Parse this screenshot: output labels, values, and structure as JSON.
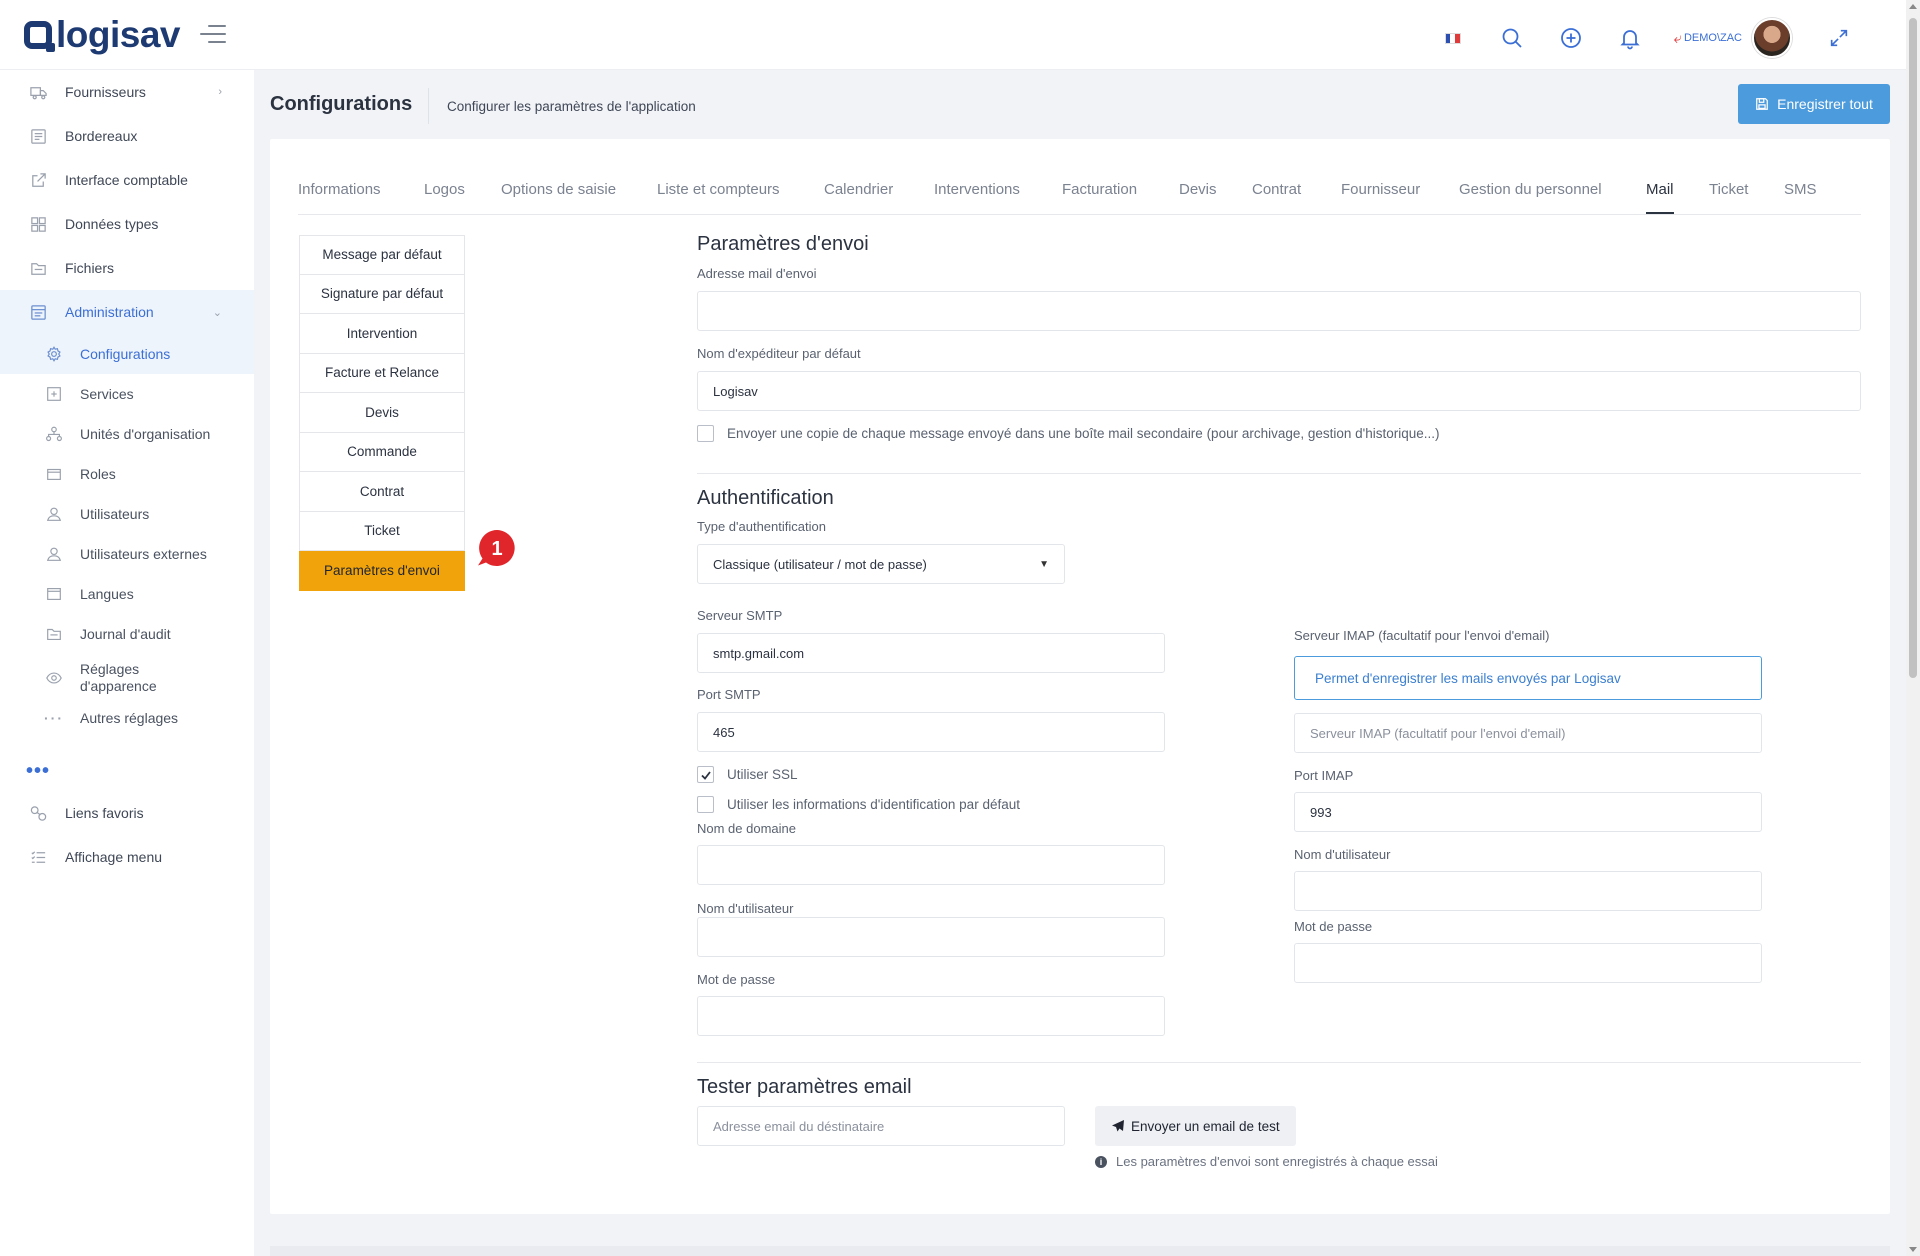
{
  "app": {
    "name": "logisav"
  },
  "topbar": {
    "user_label": "DEMO\\ZAC",
    "icons": [
      "flag-fr-icon",
      "search-icon",
      "plus-circle-icon",
      "bell-icon",
      "back-arrow-icon",
      "avatar",
      "expand-icon"
    ]
  },
  "sidebar": {
    "items": [
      {
        "label": "Fournisseurs",
        "icon": "truck-icon",
        "has_chevron": true
      },
      {
        "label": "Bordereaux",
        "icon": "ledger-icon"
      },
      {
        "label": "Interface comptable",
        "icon": "external-link-icon"
      },
      {
        "label": "Données types",
        "icon": "grid-icon"
      },
      {
        "label": "Fichiers",
        "icon": "folder-icon"
      },
      {
        "label": "Administration",
        "icon": "admin-icon",
        "expanded": true
      }
    ],
    "sub_items": [
      {
        "label": "Configurations",
        "icon": "gear-icon",
        "active": true
      },
      {
        "label": "Services",
        "icon": "services-icon"
      },
      {
        "label": "Unités d'organisation",
        "icon": "org-icon"
      },
      {
        "label": "Roles",
        "icon": "roles-icon"
      },
      {
        "label": "Utilisateurs",
        "icon": "user-icon"
      },
      {
        "label": "Utilisateurs externes",
        "icon": "user-external-icon"
      },
      {
        "label": "Langues",
        "icon": "language-icon"
      },
      {
        "label": "Journal d'audit",
        "icon": "audit-icon"
      },
      {
        "label": "Réglages d'apparence",
        "icon": "eye-icon"
      },
      {
        "label": "Autres réglages",
        "icon": "dots-icon"
      }
    ],
    "dots": "•••",
    "bottom_items": [
      {
        "label": "Liens favoris",
        "icon": "link-icon"
      },
      {
        "label": "Affichage menu",
        "icon": "list-icon"
      }
    ]
  },
  "page": {
    "title": "Configurations",
    "subtitle": "Configurer les paramètres de l'application",
    "save_all_label": "Enregistrer tout"
  },
  "tabs": [
    "Informations",
    "Logos",
    "Options de saisie",
    "Liste et compteurs",
    "Calendrier",
    "Interventions",
    "Facturation",
    "Devis",
    "Contrat",
    "Fournisseur",
    "Gestion du personnel",
    "Mail",
    "Ticket",
    "SMS"
  ],
  "active_tab": "Mail",
  "mail_menu": {
    "items": [
      "Message par défaut",
      "Signature par défaut",
      "Intervention",
      "Facture et Relance",
      "Devis",
      "Commande",
      "Contrat",
      "Ticket",
      "Paramètres d'envoi"
    ],
    "active": "Paramètres d'envoi",
    "badge": "1"
  },
  "colors": {
    "accent": "#4c9bdc",
    "active_menu": "#f0a30a",
    "badge": "#e0262b",
    "brand": "#1d3a72"
  },
  "form": {
    "envoi": {
      "title": "Paramètres d'envoi",
      "address_label": "Adresse mail d'envoi",
      "address_value": "",
      "sender_label": "Nom d'expéditeur par défaut",
      "sender_value": "Logisav",
      "copy_label": "Envoyer une copie de chaque message envoyé dans une boîte mail secondaire (pour archivage, gestion d'historique...)",
      "copy_checked": false
    },
    "auth": {
      "title": "Authentification",
      "type_label": "Type d'authentification",
      "type_value": "Classique (utilisateur / mot de passe)",
      "smtp_server_label": "Serveur SMTP",
      "smtp_server_value": "smtp.gmail.com",
      "smtp_port_label": "Port SMTP",
      "smtp_port_value": "465",
      "ssl_label": "Utiliser SSL",
      "ssl_checked": true,
      "default_cred_label": "Utiliser les informations d'identification par défaut",
      "default_cred_checked": false,
      "domain_label": "Nom de domaine",
      "domain_value": "",
      "username_label": "Nom d'utilisateur",
      "username_value": "",
      "password_label": "Mot de passe",
      "password_value": "",
      "imap_server_label": "Serveur IMAP (facultatif pour l'envoi d'email)",
      "imap_info": "Permet d'enregistrer les mails envoyés par Logisav",
      "imap_server_placeholder": "Serveur IMAP (facultatif pour l'envoi d'email)",
      "imap_port_label": "Port IMAP",
      "imap_port_value": "993",
      "imap_username_label": "Nom d'utilisateur",
      "imap_password_label": "Mot de passe"
    },
    "test": {
      "title": "Tester paramètres email",
      "recipient_placeholder": "Adresse email du déstinataire",
      "send_label": "Envoyer un email de test",
      "hint": "Les paramètres d'envoi sont enregistrés à chaque essai"
    }
  }
}
